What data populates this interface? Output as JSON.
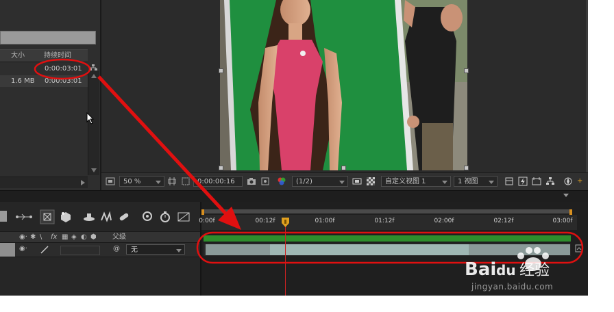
{
  "project": {
    "col_size": "大小",
    "col_duration": "持续时间",
    "rows": [
      {
        "size": "",
        "duration": "0:00:03:01"
      },
      {
        "size": "1.6 MB",
        "duration": "0:00:03:01"
      }
    ]
  },
  "viewer_toolbar": {
    "zoom": "50 %",
    "timecode": "0:00:00:16",
    "resolution": "(1/2)",
    "view_mode": "自定义视图 1",
    "view_count": "1 视图"
  },
  "timeline": {
    "col_parent": "父级",
    "parent_value": "无",
    "ruler_labels": [
      "0:00f",
      "00:12f",
      "01:00f",
      "01:12f",
      "02:00f",
      "02:12f",
      "03:00f"
    ]
  },
  "watermark": {
    "text": "jingyan.baidu.com",
    "brand": "Baidu 经验"
  },
  "colors": {
    "annotation_red": "#e01010",
    "green_screen": "#1f8f3f",
    "cti_red": "#cc2222"
  }
}
